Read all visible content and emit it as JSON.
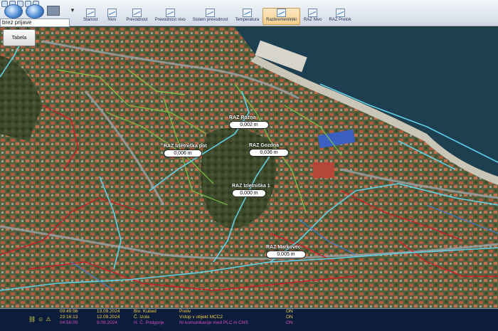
{
  "toolbar": {
    "profile_value": "brez prijave",
    "tabela_label": "Tabela",
    "layers": [
      {
        "label": "Stanost",
        "active": false
      },
      {
        "label": "Nivo",
        "active": false
      },
      {
        "label": "Prevodnost",
        "active": false
      },
      {
        "label": "Prevodnost nivo",
        "active": false
      },
      {
        "label": "Sistem prevodnost",
        "active": false
      },
      {
        "label": "Temperatura",
        "active": false
      },
      {
        "label": "Razbremenilniki",
        "active": true
      },
      {
        "label": "RAZ Nivo",
        "active": false
      },
      {
        "label": "RAZ Pretok",
        "active": false
      }
    ]
  },
  "map": {
    "markers": [
      {
        "name": "RAZ Rožna",
        "value": "0,002 m"
      },
      {
        "name": "RAZ Izletniška pot",
        "value": "0,006 m"
      },
      {
        "name": "RAZ Gozdna",
        "value": "0,036 m"
      },
      {
        "name": "RAZ Izletniška 1",
        "value": "0,000 m"
      },
      {
        "name": "RAZ Markovec",
        "value": "0,005 m"
      }
    ]
  },
  "alarms": [
    {
      "time": "09:49:56",
      "date": "13.09.2024",
      "location": "Bio. Kubed",
      "message": "Preliv",
      "state": "ON",
      "color": "#f0c94a"
    },
    {
      "time": "23:16:13",
      "date": "12.09.2024",
      "location": "Č. Izola",
      "message": "Vstop v objekt MCC2",
      "state": "ON",
      "color": "#f0c94a"
    },
    {
      "time": "04:58:00",
      "date": "9.09.2024",
      "location": "H. Č. Podgorje",
      "message": "Ni komunikacije med PLC in CNS",
      "state": "ON",
      "color": "#d24ec4"
    }
  ],
  "colors": {
    "sea": "#1d3f4f",
    "land": "#4c5a3a",
    "pipe_cyan": "#5fd0e6",
    "pipe_red": "#c8202a",
    "pipe_green": "#7ac043",
    "toolbar_active": "#f5cf8a",
    "alarm_bg": "#0b1d3a"
  },
  "icons": {
    "navigation": [
      "back-orb-icon",
      "forward-orb-icon",
      "screen-icon"
    ],
    "layer_button": "graph-icon",
    "status": [
      "network-icon",
      "user-icon",
      "warning-icon"
    ]
  }
}
